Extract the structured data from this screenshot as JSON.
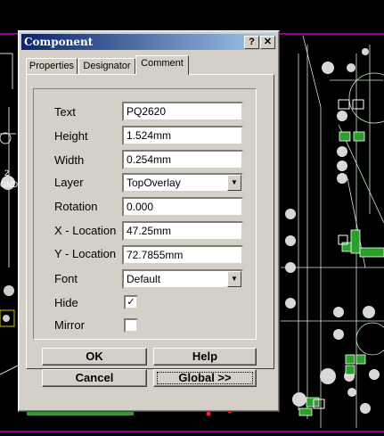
{
  "window": {
    "title": "Component",
    "help_label": "?",
    "close_label": "✕"
  },
  "tabs": [
    {
      "label": "Properties"
    },
    {
      "label": "Designator"
    },
    {
      "label": "Comment"
    }
  ],
  "fields": {
    "text": {
      "label": "Text",
      "value": "PQ2620"
    },
    "height": {
      "label": "Height",
      "value": "1.524mm"
    },
    "width": {
      "label": "Width",
      "value": "0.254mm"
    },
    "layer": {
      "label": "Layer",
      "value": "TopOverlay"
    },
    "rotation": {
      "label": "Rotation",
      "value": " 0.000"
    },
    "x_location": {
      "label": "X - Location",
      "value": "47.25mm"
    },
    "y_location": {
      "label": "Y - Location",
      "value": "72.7855mm"
    },
    "font": {
      "label": "Font",
      "value": "Default"
    },
    "hide": {
      "label": "Hide",
      "checked": true,
      "mark": "✓"
    },
    "mirror": {
      "label": "Mirror",
      "checked": false,
      "mark": ""
    }
  },
  "buttons": {
    "ok": "OK",
    "help": "Help",
    "cancel": "Cancel",
    "global": "Global >>"
  },
  "background": {
    "gnd_label": "GND",
    "net_number": "2"
  },
  "colors": {
    "titlebar_start": "#0a246a",
    "annotation_red": "#ff2020"
  }
}
